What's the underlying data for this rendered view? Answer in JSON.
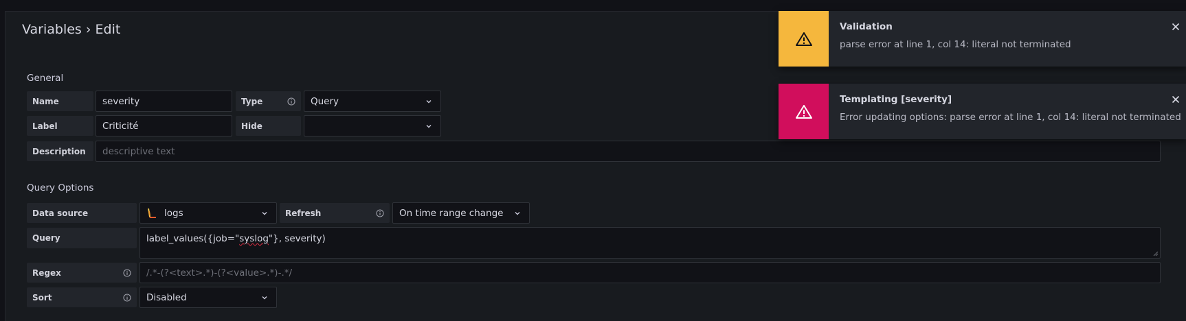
{
  "page": {
    "title": "Variables › Edit"
  },
  "general": {
    "heading": "General",
    "name_label": "Name",
    "name_value": "severity",
    "type_label": "Type",
    "type_value": "Query",
    "label_label": "Label",
    "label_value": "Criticité",
    "hide_label": "Hide",
    "hide_value": "",
    "description_label": "Description",
    "description_placeholder": "descriptive text"
  },
  "query_options": {
    "heading": "Query Options",
    "datasource_label": "Data source",
    "datasource_value": "logs",
    "datasource_icon": "loki-logo-icon",
    "refresh_label": "Refresh",
    "refresh_value": "On time range change",
    "query_label": "Query",
    "query_value_prefix": "label_values({job=\"",
    "query_value_misspelled": "syslog",
    "query_value_suffix": "\"}, severity)",
    "regex_label": "Regex",
    "regex_placeholder": "/.*-(?<text>.*)-(?<value>.*)-.*/",
    "sort_label": "Sort",
    "sort_value": "Disabled"
  },
  "toasts": [
    {
      "title": "Validation",
      "message": "parse error at line 1, col 14: literal not terminated",
      "color": "#f5b73d",
      "icon": "warning-icon"
    },
    {
      "title": "Templating [severity]",
      "message": "Error updating options: parse error at line 1, col 14: literal not terminated",
      "color": "#d10e5c",
      "icon": "warning-icon"
    }
  ],
  "colors": {
    "background": "#111217",
    "panel": "#181b1f",
    "label_bg": "#22252b",
    "warning": "#f5b73d",
    "error": "#d10e5c"
  }
}
